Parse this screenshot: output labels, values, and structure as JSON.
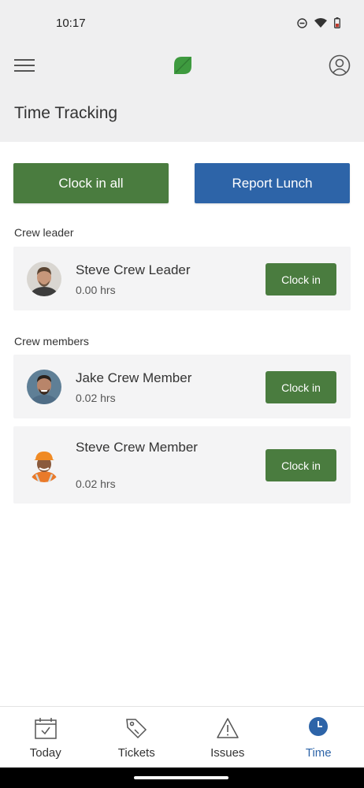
{
  "status_bar": {
    "time": "10:17",
    "icons": [
      "dnd-icon",
      "wifi-icon",
      "battery-icon"
    ]
  },
  "header": {
    "title": "Time Tracking",
    "brand_color": "#3e9a3f"
  },
  "actions": {
    "clock_in_all": "Clock in all",
    "report_lunch": "Report Lunch"
  },
  "crew_leader": {
    "section_label": "Crew leader",
    "member": {
      "name": "Steve Crew Leader",
      "hours": "0.00 hrs",
      "button": "Clock in"
    }
  },
  "crew_members": {
    "section_label": "Crew members",
    "members": [
      {
        "name": "Jake Crew Member",
        "hours": "0.02 hrs",
        "button": "Clock in"
      },
      {
        "name": "Steve Crew Member",
        "hours": "0.02 hrs",
        "button": "Clock in"
      }
    ]
  },
  "bottom_nav": {
    "items": [
      {
        "label": "Today",
        "icon": "calendar-check-icon"
      },
      {
        "label": "Tickets",
        "icon": "tag-icon"
      },
      {
        "label": "Issues",
        "icon": "warning-icon"
      },
      {
        "label": "Time",
        "icon": "clock-icon",
        "active": true
      }
    ]
  },
  "colors": {
    "primary_green": "#4a7c3f",
    "primary_blue": "#2d64a8",
    "header_bg": "#efeff0",
    "card_bg": "#f4f4f5"
  }
}
